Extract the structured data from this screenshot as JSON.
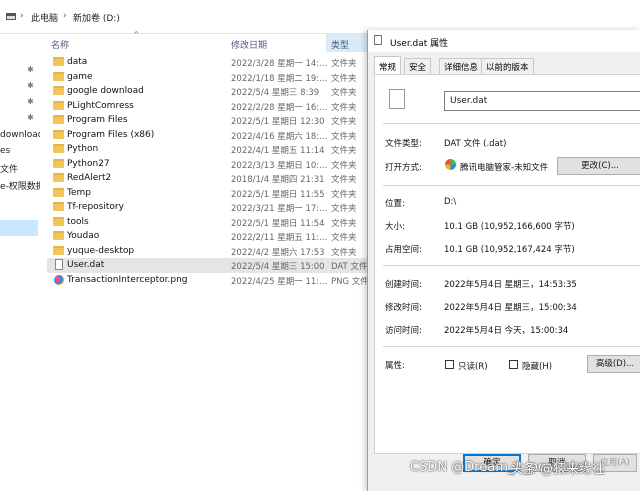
{
  "breadcrumb": {
    "part1": "此电脑",
    "part2": "新加卷 (D:)"
  },
  "nav_pane": {
    "items": [
      "download",
      "es",
      "文件",
      "e-权限数据"
    ]
  },
  "columns": {
    "name": "名称",
    "modified": "修改日期",
    "type": "类型"
  },
  "files": [
    {
      "name": "data",
      "date": "2022/3/28 星期一 14:...",
      "type": "文件夹",
      "icon": "folder-icon"
    },
    {
      "name": "game",
      "date": "2022/1/18 星期二 19:...",
      "type": "文件夹",
      "icon": "folder-icon"
    },
    {
      "name": "google download",
      "date": "2022/5/4 星期三 8:39",
      "type": "文件夹",
      "icon": "folder-icon"
    },
    {
      "name": "PLightComress",
      "date": "2022/2/28 星期一 16:...",
      "type": "文件夹",
      "icon": "folder-icon"
    },
    {
      "name": "Program Files",
      "date": "2022/5/1 星期日 12:30",
      "type": "文件夹",
      "icon": "folder-icon"
    },
    {
      "name": "Program Files (x86)",
      "date": "2022/4/16 星期六 18:...",
      "type": "文件夹",
      "icon": "folder-icon"
    },
    {
      "name": "Python",
      "date": "2022/4/1 星期五 11:14",
      "type": "文件夹",
      "icon": "folder-icon"
    },
    {
      "name": "Python27",
      "date": "2022/3/13 星期日 10:...",
      "type": "文件夹",
      "icon": "folder-icon"
    },
    {
      "name": "RedAlert2",
      "date": "2018/1/4 星期四 21:31",
      "type": "文件夹",
      "icon": "folder-icon"
    },
    {
      "name": "Temp",
      "date": "2022/5/1 星期日 11:55",
      "type": "文件夹",
      "icon": "folder-icon"
    },
    {
      "name": "Tf-repository",
      "date": "2022/3/21 星期一 17:...",
      "type": "文件夹",
      "icon": "folder-icon"
    },
    {
      "name": "tools",
      "date": "2022/5/1 星期日 11:54",
      "type": "文件夹",
      "icon": "folder-icon"
    },
    {
      "name": "Youdao",
      "date": "2022/2/11 星期五 11:...",
      "type": "文件夹",
      "icon": "folder-icon"
    },
    {
      "name": "yuque-desktop",
      "date": "2022/4/2 星期六 17:53",
      "type": "文件夹",
      "icon": "folder-icon"
    },
    {
      "name": "User.dat",
      "date": "2022/5/4 星期三 15:00",
      "type": "DAT 文件",
      "icon": "document-icon",
      "selected": true
    },
    {
      "name": "TransactionInterceptor.png",
      "date": "2022/4/25 星期一 11:...",
      "type": "PNG 文件",
      "icon": "image-icon"
    }
  ],
  "dialog": {
    "title": "User.dat 属性",
    "tabs": [
      "常规",
      "安全",
      "详细信息",
      "以前的版本"
    ],
    "file_name": "User.dat",
    "file_type_label": "文件类型:",
    "file_type_value": "DAT 文件 (.dat)",
    "opens_with_label": "打开方式:",
    "opens_with_value": "腾讯电脑管家-未知文件",
    "change_button": "更改(C)...",
    "location_label": "位置:",
    "location_value": "D:\\",
    "size_label": "大小:",
    "size_value": "10.1 GB (10,952,166,600 字节)",
    "size_on_disk_label": "占用空间:",
    "size_on_disk_value": "10.1 GB (10,952,167,424 字节)",
    "created_label": "创建时间:",
    "created_value": "2022年5月4日 星期三，14:53:35",
    "modified_label": "修改时间:",
    "modified_value": "2022年5月4日 星期三，15:00:34",
    "accessed_label": "访问时间:",
    "accessed_value": "2022年5月4日 今天，15:00:34",
    "attributes_label": "属性:",
    "readonly_label": "只读(R)",
    "hidden_label": "隐藏(H)",
    "advanced_button": "高级(D)...",
    "ok_button": "确定",
    "cancel_button": "取消",
    "apply_button": "应用(A)"
  },
  "watermark": {
    "left": "CSDN @Dream_it_possible!",
    "right": "头条 @猿来缘往"
  },
  "colors": {
    "selection": "#cce8ff",
    "folder": "#f2c55c",
    "accent": "#0078d7"
  }
}
